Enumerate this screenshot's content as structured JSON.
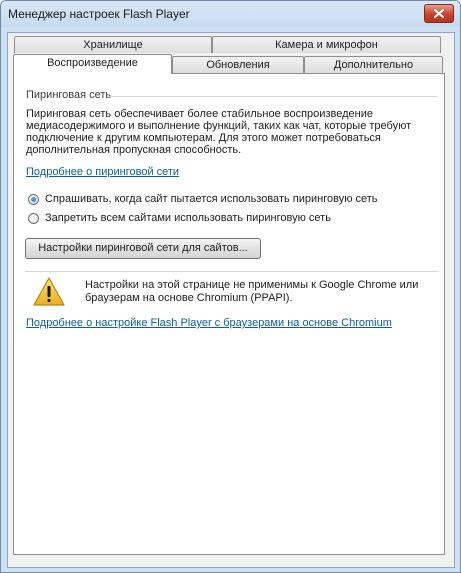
{
  "window": {
    "title": "Менеджер настроек Flash Player"
  },
  "tabs": {
    "row_back": [
      {
        "label": "Хранилище"
      },
      {
        "label": "Камера и микрофон"
      }
    ],
    "row_front": [
      {
        "label": "Воспроизведение",
        "active": true
      },
      {
        "label": "Обновления",
        "active": false
      },
      {
        "label": "Дополнительно",
        "active": false
      }
    ]
  },
  "p2p": {
    "section_title": "Пиринговая сеть",
    "description": "Пиринговая сеть обеспечивает более стабильное воспроизведение медиасодержимого и выполнение функций, таких как чат, которые требуют подключение к другим компьютерам. Для этого может потребоваться дополнительная пропускная способность.",
    "learn_more_link": "Подробнее о пиринговой сети",
    "options": [
      {
        "label": "Спрашивать, когда сайт пытается использовать пиринговую сеть",
        "checked": true
      },
      {
        "label": "Запретить всем сайтами использовать пиринговую сеть",
        "checked": false
      }
    ],
    "settings_button": "Настройки пиринговой сети для сайтов..."
  },
  "notice": {
    "icon": "warning-icon",
    "text": "Настройки на этой странице не применимы к Google Chrome или браузерам на основе Chromium (PPAPI).",
    "link": "Подробнее о настройке Flash Player с браузерами на основе Chromium"
  },
  "colors": {
    "link": "#0b5ea8",
    "titlebar": "#c7daef",
    "close_button": "#c7432b",
    "warning": "#f2c531"
  }
}
